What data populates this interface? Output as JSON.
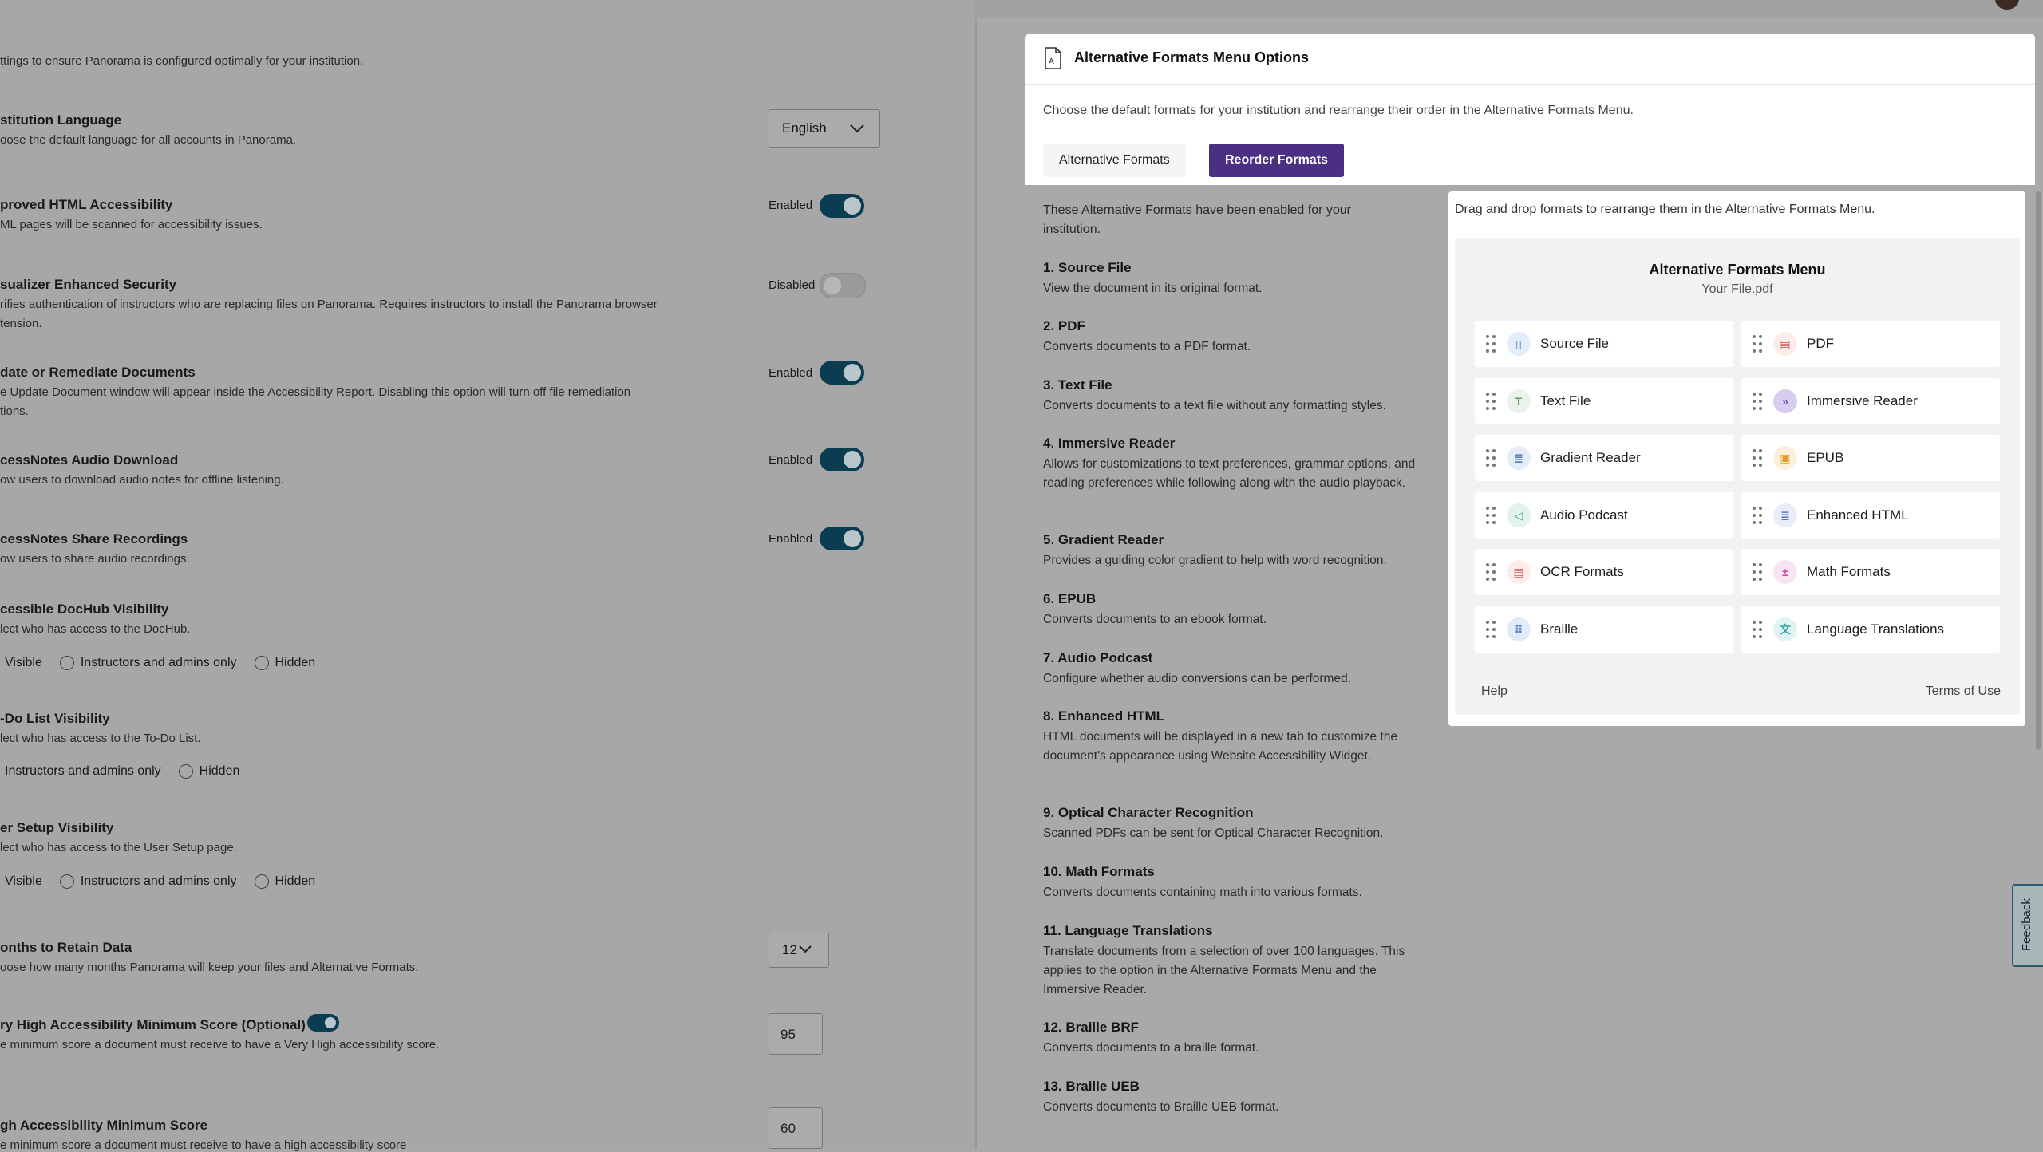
{
  "settings": {
    "intro": "ttings to ensure Panorama is configured optimally for your institution.",
    "language": {
      "title": "stitution Language",
      "desc": "oose the default language for all accounts in Panorama.",
      "value": "English"
    },
    "html": {
      "title": "proved HTML Accessibility",
      "desc": "ML pages will be scanned for accessibility issues.",
      "status": "Enabled"
    },
    "visualizer": {
      "title": "sualizer Enhanced Security",
      "desc1": "rifies authentication of instructors who are replacing files on Panorama. Requires instructors to install the Panorama browser",
      "desc2": "tension.",
      "status": "Disabled"
    },
    "update": {
      "title": "date or Remediate Documents",
      "desc1": "e Update Document window will appear inside the Accessibility Report. Disabling this option will turn off file remediation",
      "desc2": "tions.",
      "status": "Enabled"
    },
    "audio": {
      "title": "cessNotes Audio Download",
      "desc": "ow users to download audio notes for offline listening.",
      "status": "Enabled"
    },
    "share": {
      "title": "cessNotes Share Recordings",
      "desc": "ow users to share audio recordings.",
      "status": "Enabled"
    },
    "dochub": {
      "title": "cessible DocHub Visibility",
      "desc": "lect who has access to the DocHub.",
      "opt1": "Visible",
      "opt2": "Instructors and admins only",
      "opt3": "Hidden"
    },
    "todo": {
      "title": "-Do List Visibility",
      "desc": "lect who has access to the To-Do List.",
      "opt1": "Instructors and admins only",
      "opt2": "Hidden"
    },
    "usersetup": {
      "title": "er Setup Visibility",
      "desc": "lect who has access to the User Setup page.",
      "opt1": "Visible",
      "opt2": "Instructors and admins only",
      "opt3": "Hidden"
    },
    "months": {
      "title": "onths to Retain Data",
      "desc": "oose how many months Panorama will keep your files and Alternative Formats.",
      "value": "12"
    },
    "veryhigh": {
      "title": "ry High Accessibility Minimum Score (Optional)",
      "desc": "e minimum score a document must receive to have a Very High accessibility score.",
      "value": "95"
    },
    "high": {
      "title": "gh Accessibility Minimum Score",
      "desc": "e minimum score a document must receive to have a high accessibility score",
      "value": "60"
    }
  },
  "modal": {
    "title": "Alternative Formats Menu Options",
    "desc": "Choose the default formats for your institution and rearrange their order in the Alternative Formats Menu.",
    "tabs": [
      "Alternative Formats",
      "Reorder Formats"
    ],
    "intro": "These Alternative Formats have been enabled for your institution.",
    "formats": [
      {
        "title": "1. Source File",
        "desc": "View the document in its original format."
      },
      {
        "title": "2. PDF",
        "desc": "Converts documents to a PDF format."
      },
      {
        "title": "3. Text File",
        "desc": "Converts documents to a text file without any formatting styles."
      },
      {
        "title": "4. Immersive Reader",
        "desc": "Allows for customizations to text preferences, grammar options, and reading preferences while following along with the audio playback."
      },
      {
        "title": "5. Gradient Reader",
        "desc": "Provides a guiding color gradient to help with word recognition."
      },
      {
        "title": "6. EPUB",
        "desc": "Converts documents to an ebook format."
      },
      {
        "title": "7. Audio Podcast",
        "desc": "Configure whether audio conversions can be performed."
      },
      {
        "title": "8. Enhanced HTML",
        "desc": "HTML documents will be displayed in a new tab to customize the document's appearance using Website Accessibility Widget."
      },
      {
        "title": "9. Optical Character Recognition",
        "desc": "Scanned PDFs can be sent for Optical Character Recognition."
      },
      {
        "title": "10. Math Formats",
        "desc": "Converts documents containing math into various formats."
      },
      {
        "title": "11. Language Translations",
        "desc": "Translate documents from a selection of over 100 languages. This applies to the option in the Alternative Formats Menu and the Immersive Reader."
      },
      {
        "title": "12. Braille BRF",
        "desc": "Converts documents to a braille format."
      },
      {
        "title": "13. Braille UEB",
        "desc": "Converts documents to Braille UEB format."
      }
    ]
  },
  "reorder": {
    "hint": "Drag and drop formats to rearrange them in the Alternative Formats Menu.",
    "menu_title": "Alternative Formats Menu",
    "file": "Your File.pdf",
    "cards": [
      {
        "label": "Source File",
        "icon": "file-icon",
        "color": "#3a7bd5",
        "bg": "#e4eefb",
        "glyph": "▯"
      },
      {
        "label": "PDF",
        "icon": "pdf-icon",
        "color": "#d9534f",
        "bg": "#fdecea",
        "glyph": "▤"
      },
      {
        "label": "Text File",
        "icon": "text-icon",
        "color": "#6a9a6a",
        "bg": "#eaf3ea",
        "glyph": "T"
      },
      {
        "label": "Immersive Reader",
        "icon": "immersive-reader-icon",
        "color": "#6b4fb0",
        "bg": "#d8cdf0",
        "glyph": "»"
      },
      {
        "label": "Gradient Reader",
        "icon": "gradient-reader-icon",
        "color": "#4a7ec4",
        "bg": "#e5edf8",
        "glyph": "≣"
      },
      {
        "label": "EPUB",
        "icon": "epub-icon",
        "color": "#e39b2b",
        "bg": "#fcf0dc",
        "glyph": "▣"
      },
      {
        "label": "Audio Podcast",
        "icon": "speaker-icon",
        "color": "#3e9a7d",
        "bg": "#e2f3ed",
        "glyph": "◁"
      },
      {
        "label": "Enhanced HTML",
        "icon": "html-icon",
        "color": "#5b7bc4",
        "bg": "#e8edf8",
        "glyph": "≣"
      },
      {
        "label": "OCR Formats",
        "icon": "ocr-icon",
        "color": "#d9534f",
        "bg": "#fdecea",
        "glyph": "▤"
      },
      {
        "label": "Math Formats",
        "icon": "math-icon",
        "color": "#c44ca8",
        "bg": "#f8e3f2",
        "glyph": "±"
      },
      {
        "label": "Braille",
        "icon": "braille-icon",
        "color": "#4a7ec4",
        "bg": "#e1ebf8",
        "glyph": "⠿"
      },
      {
        "label": "Language Translations",
        "icon": "translate-icon",
        "color": "#3aa6a6",
        "bg": "#e0f4f4",
        "glyph": "文"
      }
    ],
    "help": "Help",
    "terms": "Terms of Use"
  },
  "feedback": "Feedback"
}
